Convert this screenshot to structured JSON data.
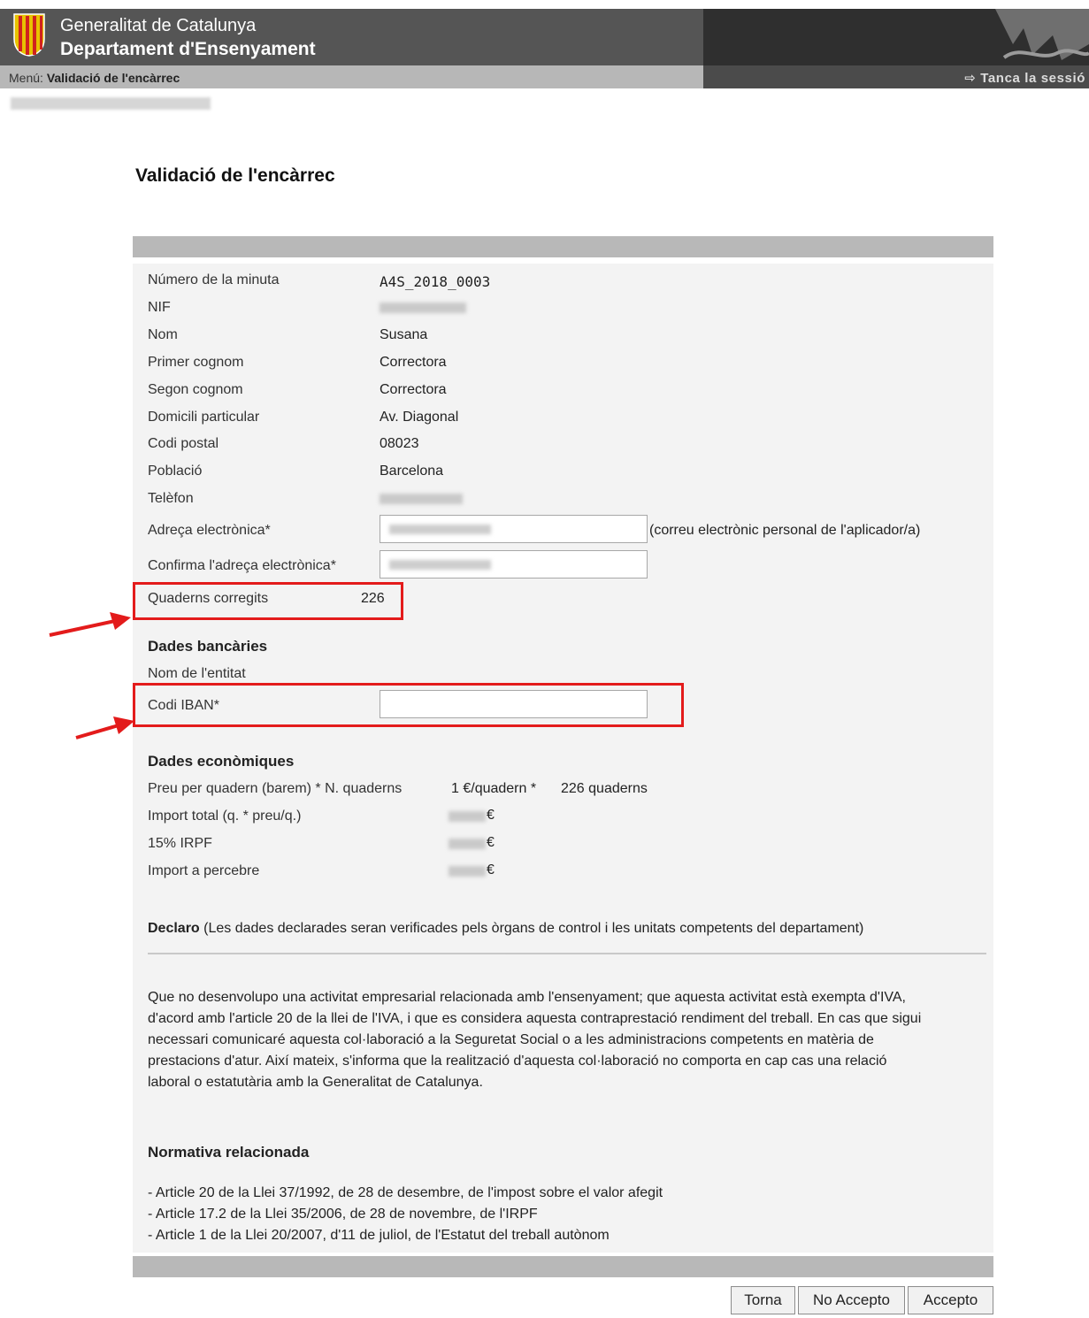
{
  "header": {
    "org": "Generalitat de Catalunya",
    "department": "Departament d'Ensenyament",
    "menu_label": "Menú:",
    "menu_value": "Validació de l'encàrrec",
    "logout": "⇨ Tanca la sessió"
  },
  "page": {
    "title": "Validació de l'encàrrec"
  },
  "form": {
    "minute_label": "Número de la minuta",
    "minute_value": "A4S_2018_0003",
    "nif_label": "NIF",
    "nom_label": "Nom",
    "nom_value": "Susana",
    "cognom1_label": "Primer cognom",
    "cognom1_value": "Correctora",
    "cognom2_label": "Segon cognom",
    "cognom2_value": "Correctora",
    "domicili_label": "Domicili particular",
    "domicili_value": "Av. Diagonal",
    "cp_label": "Codi postal",
    "cp_value": "08023",
    "poblacio_label": "Població",
    "poblacio_value": "Barcelona",
    "telefon_label": "Telèfon",
    "email_label": "Adreça electrònica*",
    "email_hint": "(correu electrònic personal de l'aplicador/a)",
    "email_confirm_label": "Confirma l'adreça electrònica*",
    "quaderns_label": "Quaderns corregits",
    "quaderns_value": "226"
  },
  "bank": {
    "title": "Dades bancàries",
    "entity_label": "Nom de l'entitat",
    "iban_label": "Codi IBAN*",
    "iban_value": ""
  },
  "econ": {
    "title": "Dades econòmiques",
    "price_label": "Preu per quadern (barem) * N. quaderns",
    "price_value": "1 €/quadern *",
    "price_count": "226 quaderns",
    "total_label": "Import total (q. * preu/q.)",
    "irpf_label": "15% IRPF",
    "net_label": "Import a percebre",
    "currency": "€"
  },
  "declaration": {
    "title": "Declaro",
    "title_note": "(Les dades declarades seran verificades pels òrgans de control i les unitats competents del departament)",
    "text": "Que no desenvolupo una activitat empresarial relacionada amb l'ensenyament; que aquesta activitat està exempta d'IVA, d'acord amb l'article 20 de la llei de l'IVA, i que es considera aquesta contraprestació rendiment del treball. En cas que sigui necessari comunicaré aquesta col·laboració a la Seguretat Social o a les administracions competents en matèria de prestacions d'atur. Així mateix, s'informa que la realització d'aquesta col·laboració no comporta en cap cas una relació laboral o estatutària amb la Generalitat de Catalunya."
  },
  "normativa": {
    "title": "Normativa relacionada",
    "items": [
      "- Article 20 de la Llei 37/1992, de 28 de desembre, de l'impost sobre el valor afegit",
      "- Article 17.2 de la Llei 35/2006, de 28 de novembre, de l'IRPF",
      "- Article 1 de la Llei 20/2007, d'11 de juliol, de l'Estatut del treball autònom"
    ]
  },
  "buttons": {
    "back": "Torna",
    "reject": "No Accepto",
    "accept": "Accepto"
  },
  "colors": {
    "highlight": "#e31b1b",
    "header": "#555555",
    "bar": "#b8b8b8"
  }
}
